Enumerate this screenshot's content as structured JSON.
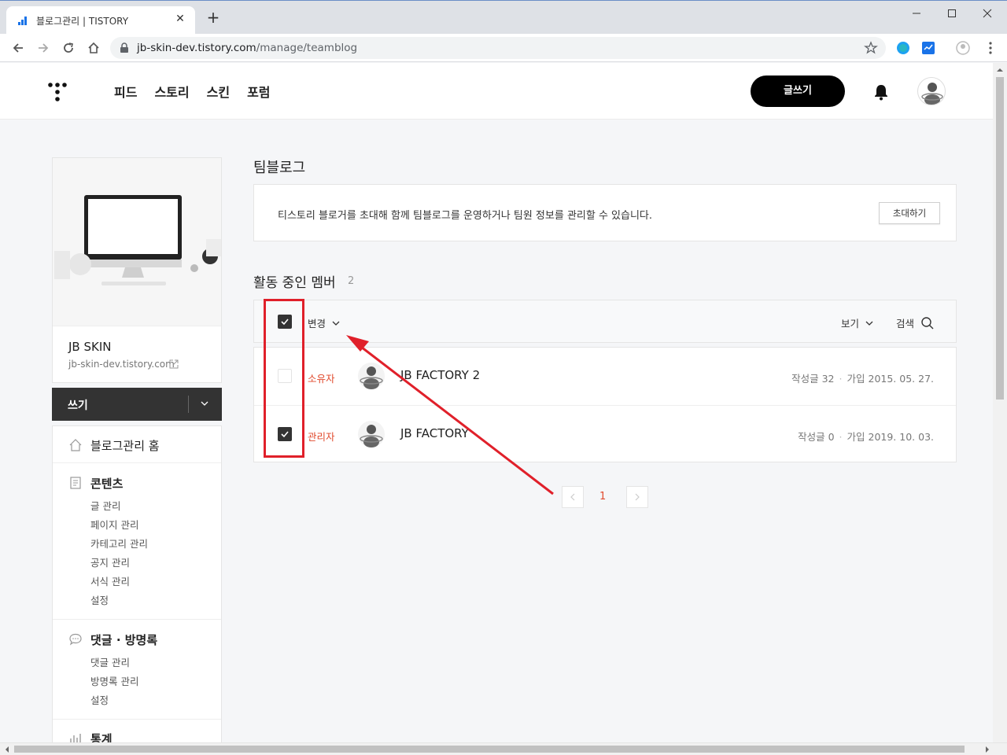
{
  "browser": {
    "tab_title": "블로그관리 | TISTORY",
    "url_host": "jb-skin-dev.tistory.com",
    "url_path": "/manage/teamblog"
  },
  "gnb": {
    "menu": [
      "피드",
      "스토리",
      "스킨",
      "포럼"
    ],
    "write_label": "글쓰기"
  },
  "sidebar": {
    "blog_name": "JB SKIN",
    "blog_url": "jb-skin-dev.tistory.com",
    "write_label": "쓰기",
    "home_label": "블로그관리 홈",
    "content_head": "콘텐츠",
    "content_items": [
      "글 관리",
      "페이지 관리",
      "카테고리 관리",
      "공지 관리",
      "서식 관리",
      "설정"
    ],
    "comment_head": "댓글 · 방명록",
    "comment_items": [
      "댓글 관리",
      "방명록 관리",
      "설정"
    ],
    "stats_head": "통계"
  },
  "main": {
    "title": "팀블로그",
    "info_text": "티스토리 블로거를 초대해 함께 팀블로그를 운영하거나 팀원 정보를 관리할 수 있습니다.",
    "invite_label": "초대하기",
    "members_title": "활동 중인 멤버",
    "members_count": "2",
    "head_change": "변경",
    "head_view": "보기",
    "head_search": "검색",
    "members": [
      {
        "checked": false,
        "role": "소유자",
        "name": "JB FACTORY 2",
        "posts_label": "작성글",
        "posts": "32",
        "join_label": "가입",
        "joined": "2015. 05. 27."
      },
      {
        "checked": true,
        "role": "관리자",
        "name": "JB FACTORY",
        "posts_label": "작성글",
        "posts": "0",
        "join_label": "가입",
        "joined": "2019. 10. 03."
      }
    ],
    "page_current": "1"
  },
  "colors": {
    "accent": "#e14a2d",
    "annotation": "#e0202a",
    "dark": "#333333"
  }
}
